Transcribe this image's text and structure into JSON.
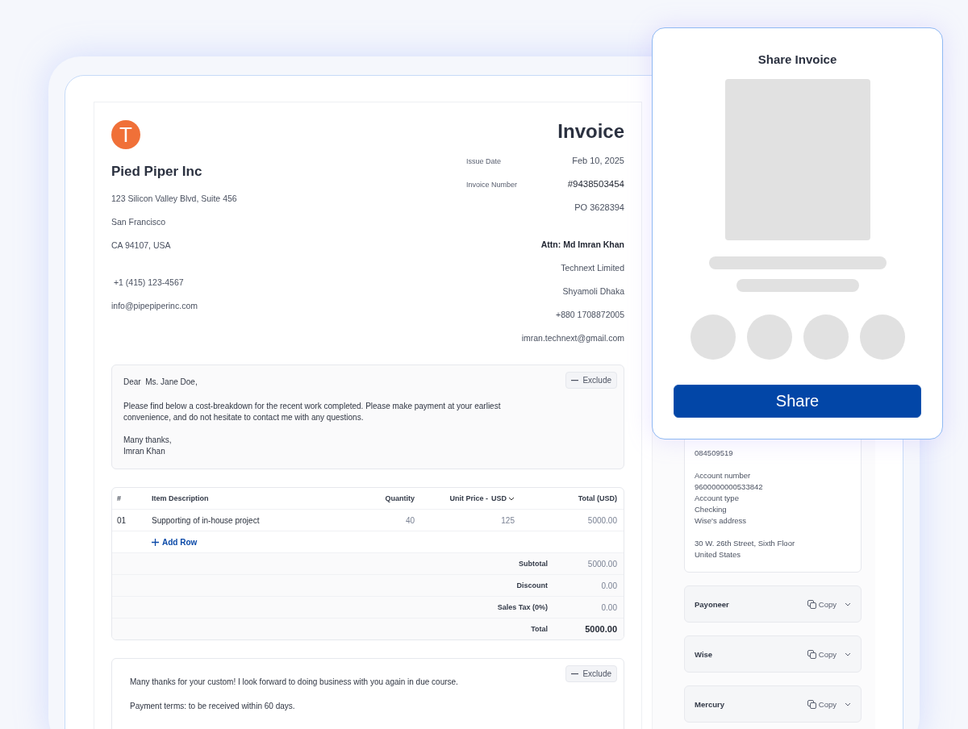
{
  "invoice": {
    "logo_letter": "T",
    "title": "Invoice",
    "company": {
      "name": "Pied Piper Inc",
      "address": [
        "123 Silicon Valley Blvd, Suite 456",
        "San Francisco",
        "CA 94107, USA"
      ],
      "contact": [
        " +1 (415) 123-4567",
        "info@pipepiperinc.com"
      ]
    },
    "meta": [
      {
        "label": "Issue Date",
        "value": "Feb 10, 2025",
        "kind": "plain"
      },
      {
        "label": "Invoice Number",
        "value": "#9438503454",
        "kind": "strong"
      },
      {
        "value": "PO 3628394",
        "kind": "plain"
      }
    ],
    "recipient": {
      "attn": "Attn: Md Imran Khan",
      "lines": [
        "Technext Limited",
        "Shyamoli Dhaka",
        "+880 1708872005",
        "imran.technext@gmail.com"
      ]
    },
    "letter": {
      "exclude": "Exclude",
      "greeting": "Dear  Ms. Jane Doe,",
      "body": "Please find below a cost-breakdown for the recent work completed. Please make payment at your earliest convenience, and do not hesitate to contact me with any questions.",
      "closing": [
        "Many thanks,",
        "Imran Khan"
      ]
    },
    "table": {
      "columns": [
        "#",
        "Item Description",
        "Quantity",
        "Unit Price -",
        "Total (USD)"
      ],
      "currency": "USD",
      "rows": [
        {
          "num": "01",
          "description": "Supporting of in-house project",
          "quantity": "40",
          "unit_price": "125",
          "total": "5000.00"
        }
      ],
      "add_row": "Add Row",
      "totals": [
        {
          "label": "Subtotal",
          "value": "5000.00",
          "kind": "plain"
        },
        {
          "label": "Discount",
          "value": "0.00",
          "kind": "plain"
        },
        {
          "label": "Sales Tax (0%)",
          "value": "0.00",
          "kind": "plain"
        },
        {
          "label": "Total",
          "value": "5000.00",
          "kind": "grand"
        }
      ]
    },
    "notes": {
      "exclude": "Exclude",
      "lines": [
        "Many thanks for your custom! I look forward to doing business with you again in due course.",
        "Payment terms: to be received within 60 days."
      ]
    }
  },
  "payment": {
    "bank_blocks": [
      [
        "084509519"
      ],
      [
        "Account number",
        "9600000000533842",
        "Account type",
        "Checking",
        "Wise's address"
      ],
      [
        "30 W. 26th Street, Sixth Floor",
        "United States"
      ]
    ],
    "methods": [
      {
        "name": "Payoneer",
        "action": "Copy"
      },
      {
        "name": "Wise",
        "action": "Copy"
      },
      {
        "name": "Mercury",
        "action": "Copy"
      }
    ]
  },
  "share_dialog": {
    "title": "Share Invoice",
    "button": "Share"
  }
}
